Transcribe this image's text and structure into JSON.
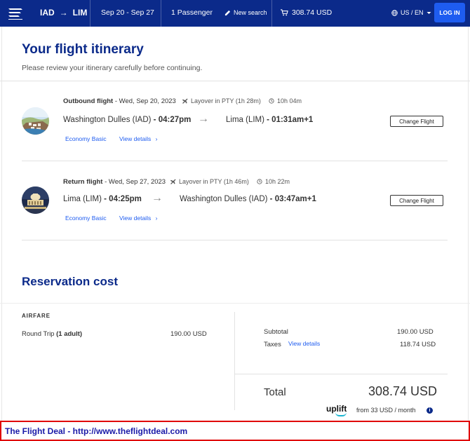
{
  "header": {
    "origin": "IAD",
    "destination": "LIM",
    "dates": "Sep 20 - Sep 27",
    "passengers": "1 Passenger",
    "new_search": "New search",
    "cart_total": "308.74 USD",
    "locale": "US / EN",
    "login": "LOG IN"
  },
  "itinerary": {
    "title": "Your flight itinerary",
    "subtitle": "Please review your itinerary carefully before continuing."
  },
  "flights": [
    {
      "label": "Outbound flight",
      "date": " - Wed, Sep 20, 2023",
      "layover": "Layover in PTY (1h 28m)",
      "duration": "10h 04m",
      "from_city": "Washington Dulles (IAD)",
      "from_time": " - 04:27pm",
      "to_city": "Lima (LIM)",
      "to_time": " - 01:31am+1",
      "fare_class": "Economy Basic",
      "details": "View details",
      "change": "Change Flight"
    },
    {
      "label": "Return flight",
      "date": " - Wed, Sep 27, 2023",
      "layover": "Layover in PTY (1h 46m)",
      "duration": "10h 22m",
      "from_city": "Lima (LIM)",
      "from_time": " - 04:25pm",
      "to_city": "Washington Dulles (IAD)",
      "to_time": " - 03:47am+1",
      "fare_class": "Economy Basic",
      "details": "View details",
      "change": "Change Flight"
    }
  ],
  "reservation": {
    "title": "Reservation cost",
    "airfare_label": "AIRFARE",
    "trip_type": "Round Trip ",
    "adults": "(1 adult)",
    "airfare_amount": "190.00 USD",
    "subtotal_label": "Subtotal",
    "subtotal_amount": "190.00 USD",
    "taxes_label": "Taxes",
    "taxes_details": "View details",
    "taxes_amount": "118.74 USD",
    "total_label": "Total",
    "total_amount": "308.74 USD",
    "uplift_brand": "uplift",
    "monthly": "from 33 USD  / month",
    "info": "i"
  },
  "banner": {
    "text": "The Flight Deal - http://www.theflightdeal.com"
  },
  "icons": {
    "logo": "airline-logo-icon",
    "route_arrow": "→",
    "new_search": "pencil-icon",
    "cart": "cart-icon",
    "globe": "globe-icon",
    "chevron": "chevron-down-icon",
    "plane": "plane-icon",
    "clock": "clock-icon",
    "flight_arrow": "→",
    "chevron_right": "›"
  },
  "colors": {
    "brand_navy": "#0b2a8a",
    "accent_blue": "#1e5cf0",
    "banner_border": "#e00000"
  }
}
